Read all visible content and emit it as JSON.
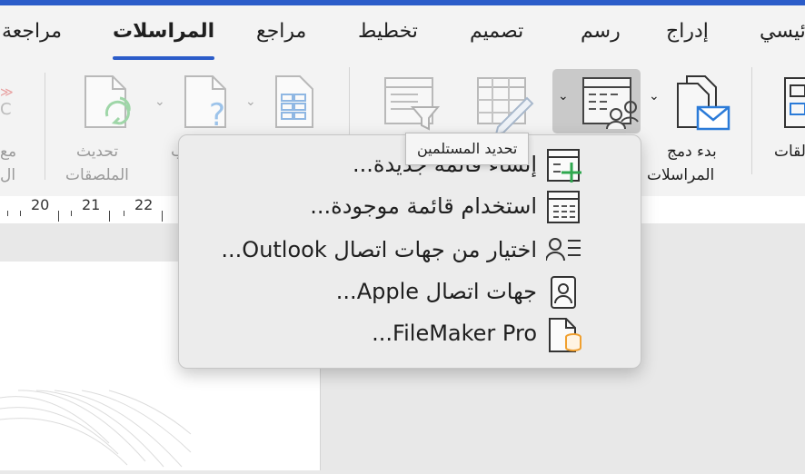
{
  "tabs": [
    {
      "label": "مراجعة",
      "active": false
    },
    {
      "label": "المراسلات",
      "active": true
    },
    {
      "label": "مراجع",
      "active": false
    },
    {
      "label": "تخطيط",
      "active": false
    },
    {
      "label": "تصميم",
      "active": false
    },
    {
      "label": "رسم",
      "active": false
    },
    {
      "label": "إدراج",
      "active": false
    },
    {
      "label": "ئيسي",
      "active": false
    }
  ],
  "ribbon": {
    "left_cut_top": "مع",
    "left_cut_bottom": "ال",
    "update_labels_line1": "تحديث",
    "update_labels_line2": "الملصقات",
    "cut_char": "ب",
    "start_mail_merge_line1": "بدء دمج",
    "start_mail_merge_line2": "المراسلات",
    "labels_cut": "لقات"
  },
  "tooltip": "تحديد المستلمين",
  "ruler": [
    "20",
    "21",
    "22"
  ],
  "menu": {
    "items": [
      {
        "label": "إنشاء قائمة جديدة...",
        "icon": "new-list-icon"
      },
      {
        "label": "استخدام قائمة موجودة...",
        "icon": "existing-list-icon"
      },
      {
        "label": "اختيار من جهات اتصال Outlook...",
        "icon": "outlook-contacts-icon"
      },
      {
        "label": "جهات اتصال Apple...",
        "icon": "apple-contacts-icon"
      },
      {
        "label": "FileMaker Pro...",
        "icon": "filemaker-icon"
      }
    ]
  },
  "colors": {
    "accent": "#2b5cc9",
    "green": "#2fa84f",
    "orange": "#f0a030",
    "blue_envelope": "#2b7bd8"
  }
}
